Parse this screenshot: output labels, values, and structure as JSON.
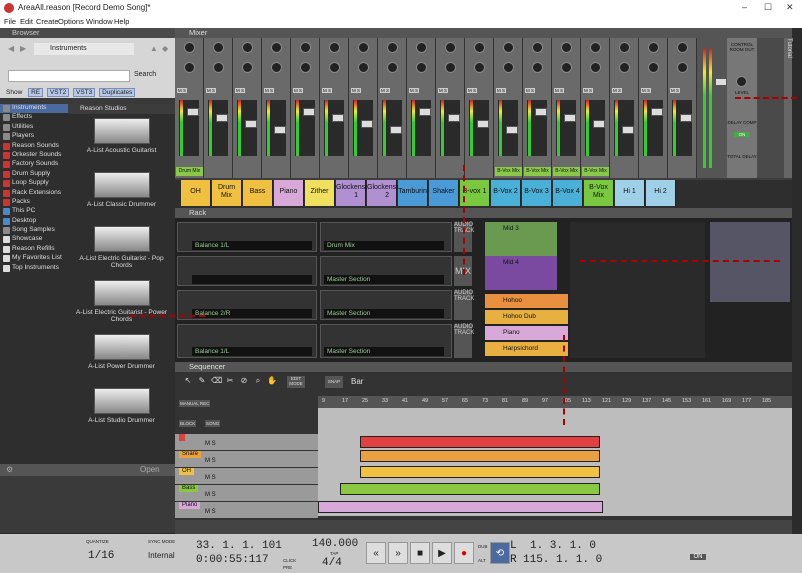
{
  "window": {
    "title": "AreaAll.reason [Record Demo Song]*",
    "controls": [
      "–",
      "☐",
      "✕"
    ]
  },
  "menu": [
    "File",
    "Edit",
    "Create",
    "Options",
    "Window",
    "Help"
  ],
  "browser": {
    "title": "Browser",
    "location": "Instruments",
    "search_label": "Search",
    "filters": {
      "show": "Show",
      "items": [
        "RE",
        "VST2",
        "VST3",
        "Duplicates"
      ]
    },
    "locations": [
      {
        "label": "Instruments",
        "color": "#8a8a8a",
        "selected": true
      },
      {
        "label": "Effects",
        "color": "#8a8a8a"
      },
      {
        "label": "Utilities",
        "color": "#8a8a8a"
      },
      {
        "label": "Players",
        "color": "#8a8a8a"
      },
      {
        "label": "Reason Sounds",
        "color": "#c33"
      },
      {
        "label": "Orkester Sounds",
        "color": "#c33"
      },
      {
        "label": "Factory Sounds",
        "color": "#c33"
      },
      {
        "label": "Drum Supply",
        "color": "#c33"
      },
      {
        "label": "Loop Supply",
        "color": "#c33"
      },
      {
        "label": "Rack Extensions",
        "color": "#c33"
      },
      {
        "label": "Packs",
        "color": "#c33"
      },
      {
        "label": "This PC",
        "color": "#4a8ac8"
      },
      {
        "label": "Desktop",
        "color": "#4a8ac8"
      },
      {
        "label": "Song Samples",
        "color": "#8a8a8a"
      },
      {
        "label": "Showcase",
        "color": "#ddd"
      },
      {
        "label": "Reason Refills",
        "color": "#ddd"
      },
      {
        "label": "My Favorites List",
        "color": "#ddd"
      },
      {
        "label": "Top Instruments",
        "color": "#ddd"
      }
    ],
    "content_header": "Reason Studios",
    "patches": [
      "A-List Acoustic Guitarist",
      "A-List Classic Drummer",
      "A-List Electric Guitarist - Pop Chords",
      "A-List Electric Guitarist - Power Chords",
      "A-List Power Drummer",
      "A-List Studio Drummer"
    ],
    "open_label": "Open"
  },
  "mixer": {
    "title": "Mixer",
    "channels": [
      "Drum Mix",
      "",
      "",
      "",
      "",
      "",
      "",
      "",
      "",
      "",
      "",
      "B-Vox Mix",
      "B-Vox Mix",
      "B-Vox Mix",
      "B-Vox Mix",
      "",
      "",
      ""
    ],
    "track_chips": [
      {
        "label": "OH",
        "color": "#f0c040"
      },
      {
        "label": "Drum Mix",
        "color": "#f0c040"
      },
      {
        "label": "Bass",
        "color": "#f0c040"
      },
      {
        "label": "Piano",
        "color": "#d8a8d8"
      },
      {
        "label": "Zither",
        "color": "#f0e060"
      },
      {
        "label": "Glockenspiel 1",
        "color": "#b090d0"
      },
      {
        "label": "Glockenspiel 2",
        "color": "#b090d0"
      },
      {
        "label": "Tamburin",
        "color": "#4a9ad8"
      },
      {
        "label": "Shaker",
        "color": "#4a9ad8"
      },
      {
        "label": "B-vox 1",
        "color": "#7ac840"
      },
      {
        "label": "B-Vox 2",
        "color": "#4ab0d8"
      },
      {
        "label": "B-Vox 3",
        "color": "#4ab0d8"
      },
      {
        "label": "B-Vox 4",
        "color": "#4ab0d8"
      },
      {
        "label": "B-Vox Mix",
        "color": "#7ac840"
      },
      {
        "label": "Hi 1",
        "color": "#a0d0e8"
      },
      {
        "label": "Hi 2",
        "color": "#a0d0e8"
      }
    ],
    "control_room": {
      "title": "CONTROL ROOM OUT",
      "level": "LEVEL",
      "delay_comp": "DELAY COMP",
      "on": "ON",
      "total_delay": "TOTAL DELAY"
    },
    "side_label": "Tutorial"
  },
  "rack": {
    "title": "Rack",
    "left_devices": [
      "Balance 1/L",
      "",
      "Balance 2/R",
      "Balance 1/L"
    ],
    "middle_devices": [
      "Drum Mix",
      "Master Section",
      "Master Section",
      "Master Section"
    ],
    "labels": [
      "AUDIO TRACK",
      "MIX",
      "AUDIO TRACK",
      "AUDIO TRACK"
    ],
    "right_devices": [
      {
        "label": "Mid 3",
        "color": "#6a9a50"
      },
      {
        "label": "Mid 4",
        "color": "#7a4aa0"
      }
    ],
    "instruments": [
      {
        "label": "Hohoo",
        "color": "#e89040"
      },
      {
        "label": "Hohoo Dub",
        "color": "#e8b040"
      },
      {
        "label": "Piano",
        "color": "#d8a8d8"
      },
      {
        "label": "Harpsichord",
        "color": "#e8b040"
      }
    ]
  },
  "sequencer": {
    "title": "Sequencer",
    "mode_labels": [
      "EDIT MODE",
      "SNAP",
      "Bar"
    ],
    "lane_labels": [
      "MANUAL REC",
      "BLOCK",
      "SONG"
    ],
    "tracks": [
      {
        "name": "",
        "color": "#e04040"
      },
      {
        "name": "Snare",
        "color": "#e8a040"
      },
      {
        "name": "OH",
        "color": "#f0c040"
      },
      {
        "name": "Bass",
        "color": "#8ac840"
      },
      {
        "name": "Piano",
        "color": "#d8a8d8"
      }
    ],
    "ruler": [
      "9",
      "17",
      "25",
      "33",
      "41",
      "49",
      "57",
      "65",
      "73",
      "81",
      "89",
      "97",
      "105",
      "113",
      "121",
      "129",
      "137",
      "145",
      "153",
      "161",
      "169",
      "177",
      "185"
    ]
  },
  "transport": {
    "quantize": "1/16",
    "sync_mode": "Internal",
    "position_bars": "33. 1. 1. 101",
    "position_time": "0:00:55:117",
    "tempo": "140.000",
    "signature": "4/4",
    "loop_left": "1. 3. 1. 0",
    "loop_right": "115. 1. 1. 0",
    "labels": {
      "quantize": "QUANTIZE",
      "sync": "SYNC MODE",
      "tap": "TAP",
      "dub": "DUB",
      "alt": "ALT",
      "l": "L",
      "r": "R",
      "on": "ON",
      "click": "CLICK",
      "pre": "PRE"
    }
  },
  "colors": {
    "accent": "#a00000",
    "panel": "#3d3d3d"
  }
}
